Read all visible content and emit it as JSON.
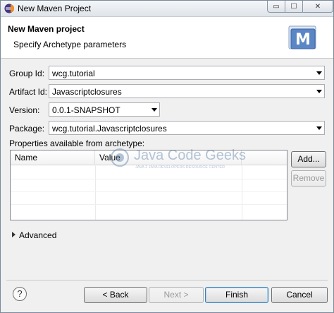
{
  "window": {
    "title": "New Maven Project",
    "controls": {
      "minimize": "▭",
      "maximize": "☐",
      "close": "✕"
    }
  },
  "header": {
    "title": "New Maven project",
    "subtitle": "Specify Archetype parameters",
    "logo_letter": "M"
  },
  "form": {
    "group_id": {
      "label": "Group Id:",
      "value": "wcg.tutorial"
    },
    "artifact_id": {
      "label": "Artifact Id:",
      "value": "Javascriptclosures"
    },
    "version": {
      "label": "Version:",
      "value": "0.0.1-SNAPSHOT"
    },
    "package": {
      "label": "Package:",
      "value": "wcg.tutorial.Javascriptclosures"
    }
  },
  "properties": {
    "label": "Properties available from archetype:",
    "columns": [
      "Name",
      "Value"
    ],
    "rows": [],
    "add_button": "Add...",
    "remove_button": "Remove"
  },
  "advanced": {
    "label": "Advanced"
  },
  "watermark": {
    "brand": "Java Code Geeks",
    "tagline": "JAVA 2 JAVA DEVELOPERS RESOURCE CENTER"
  },
  "footer": {
    "help": "?",
    "back": "< Back",
    "next": "Next >",
    "finish": "Finish",
    "cancel": "Cancel"
  }
}
